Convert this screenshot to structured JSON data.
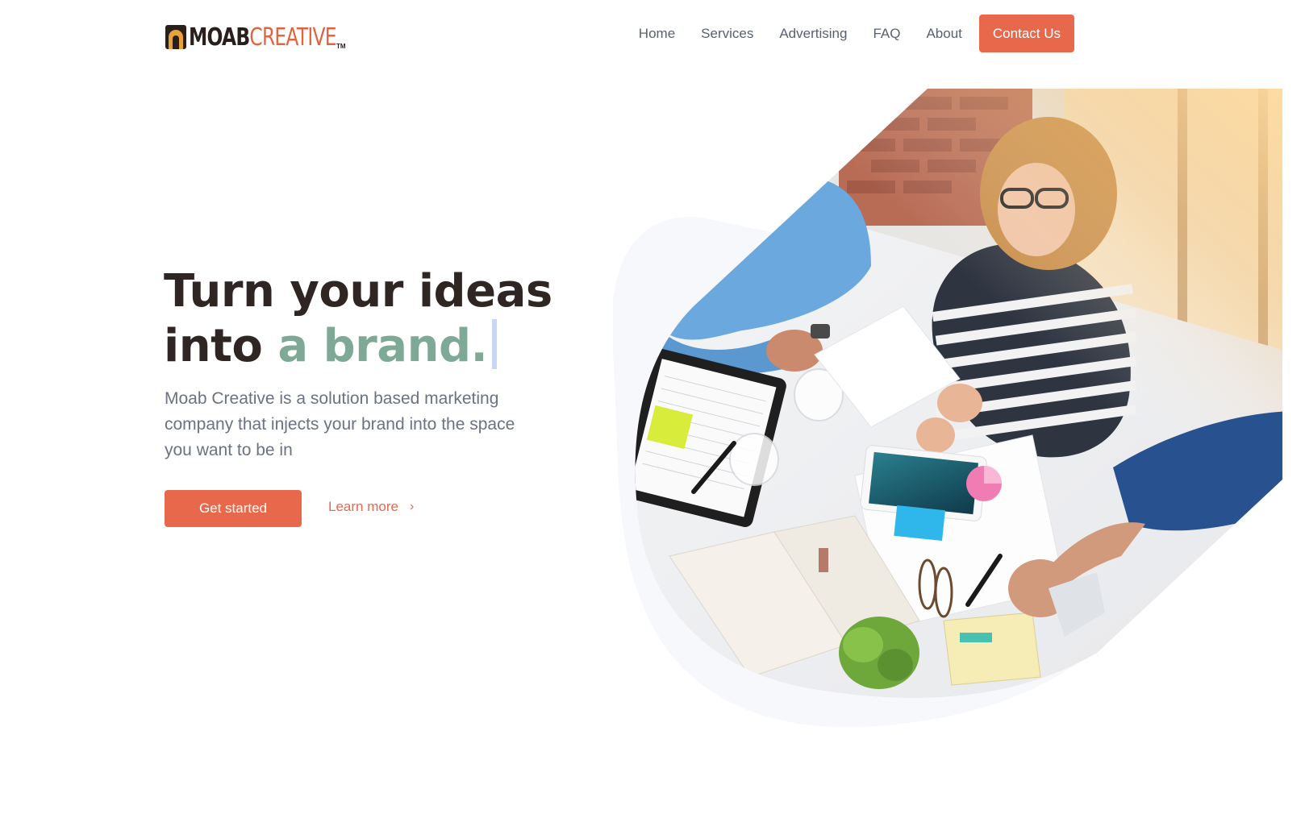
{
  "brand": {
    "logo_part1": "MOAB",
    "logo_part2": "CREATIVE",
    "trademark": "TM"
  },
  "nav": {
    "items": [
      {
        "label": "Home"
      },
      {
        "label": "Services"
      },
      {
        "label": "Advertising"
      },
      {
        "label": "FAQ"
      },
      {
        "label": "About"
      }
    ],
    "contact_label": "Contact Us"
  },
  "hero": {
    "headline_line1": "Turn your ideas",
    "headline_line2_prefix": "into ",
    "headline_accent": "a brand.",
    "description": "Moab Creative is a solution based marketing company that injects your brand into the space you want to be in",
    "primary_cta": "Get started",
    "secondary_cta": "Learn more",
    "secondary_icon": "chevron-right-icon"
  },
  "colors": {
    "accent": "#e8684b",
    "headline": "#2f2523",
    "headline_accent": "#7fa997",
    "body_text": "#6b7280",
    "blob_bg": "#f7f8fc"
  }
}
